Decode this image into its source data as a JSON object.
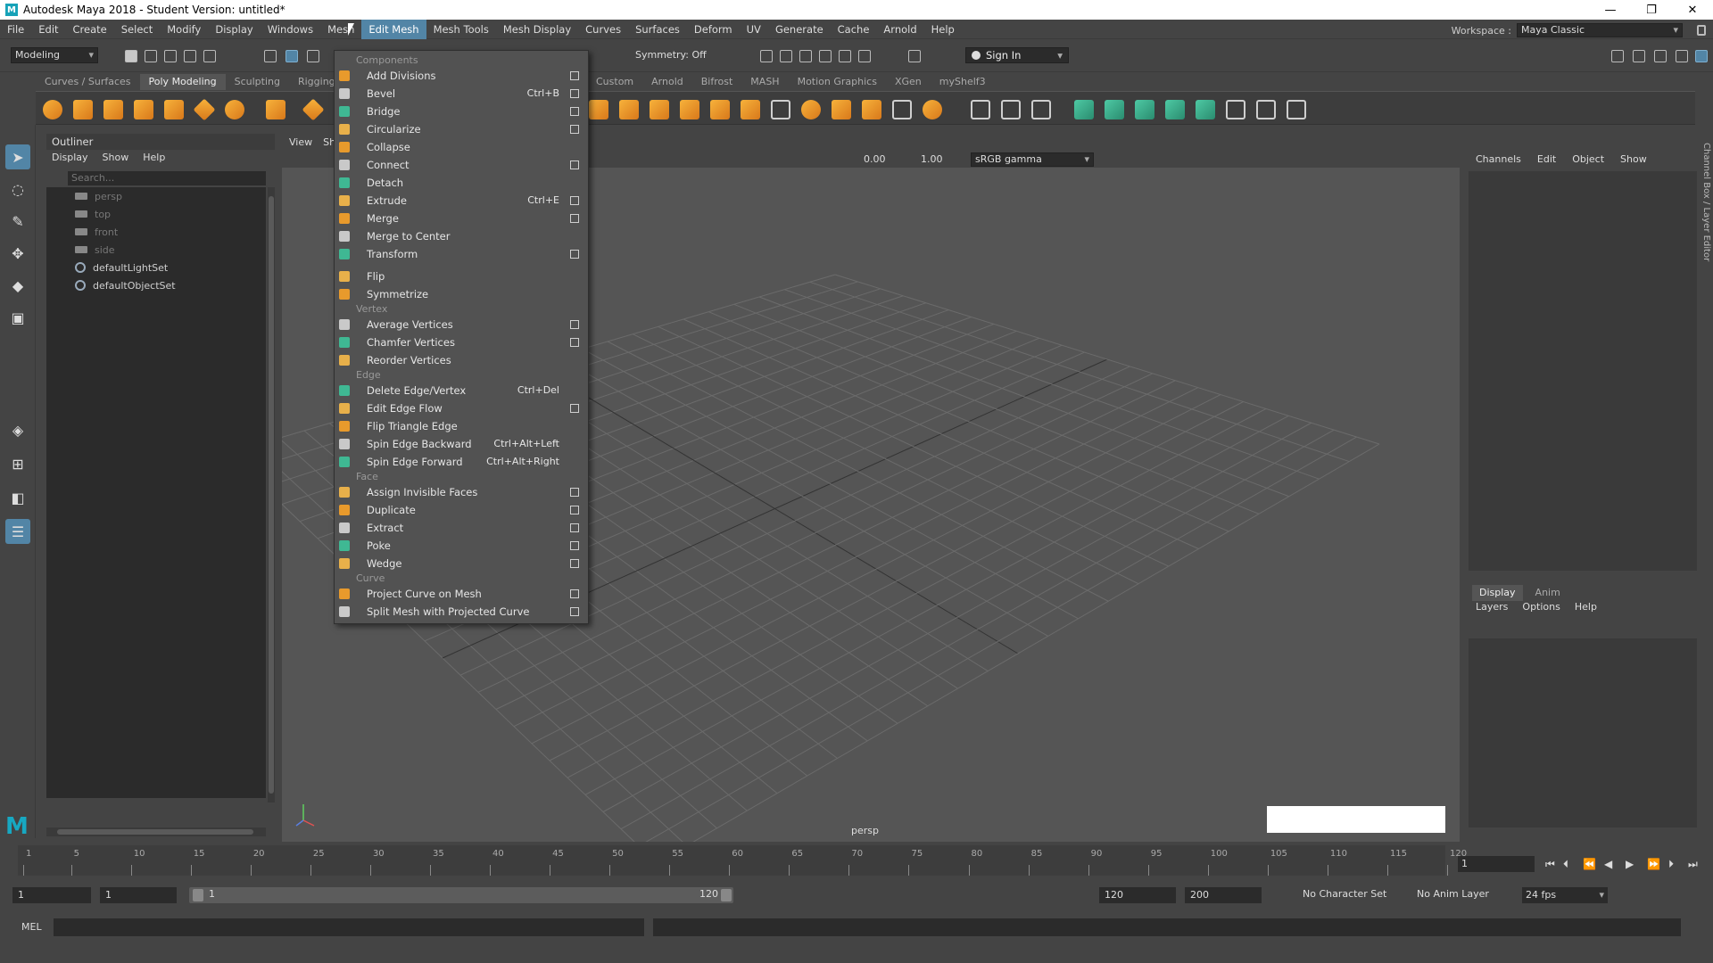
{
  "window": {
    "title": "Autodesk Maya 2018 - Student Version: untitled*",
    "minimize": "—",
    "maximize": "❐",
    "close": "✕"
  },
  "menubar": {
    "items": [
      "File",
      "Edit",
      "Create",
      "Select",
      "Modify",
      "Display",
      "Windows",
      "Mesh",
      "Edit Mesh",
      "Mesh Tools",
      "Mesh Display",
      "Curves",
      "Surfaces",
      "Deform",
      "UV",
      "Generate",
      "Cache",
      "Arnold",
      "Help"
    ],
    "active": "Edit Mesh",
    "workspace_label": "Workspace :",
    "workspace_value": "Maya Classic"
  },
  "statusline": {
    "mode": "Modeling",
    "symmetry": "Symmetry: Off",
    "sign_in": "Sign In"
  },
  "shelf": {
    "tabs": [
      "Curves / Surfaces",
      "Poly Modeling",
      "Sculpting",
      "Rigging"
    ],
    "tabs_right": [
      "Custom",
      "Arnold",
      "Bifrost",
      "MASH",
      "Motion Graphics",
      "XGen",
      "myShelf3"
    ],
    "active_tab": "Poly Modeling"
  },
  "outliner": {
    "title": "Outliner",
    "menu": [
      "Display",
      "Show",
      "Help"
    ],
    "search_placeholder": "Search...",
    "items": [
      {
        "label": "persp",
        "type": "camera",
        "dim": true
      },
      {
        "label": "top",
        "type": "camera",
        "dim": true
      },
      {
        "label": "front",
        "type": "camera",
        "dim": true
      },
      {
        "label": "side",
        "type": "camera",
        "dim": true
      },
      {
        "label": "defaultLightSet",
        "type": "set",
        "dim": false
      },
      {
        "label": "defaultObjectSet",
        "type": "set",
        "dim": false
      }
    ]
  },
  "viewport": {
    "menu": [
      "View",
      "Sh"
    ],
    "exposure": "0.00",
    "gamma_value": "1.00",
    "color_space": "sRGB gamma",
    "camera_label": "persp"
  },
  "channelbox": {
    "menu": [
      "Channels",
      "Edit",
      "Object",
      "Show"
    ],
    "layer_tabs": [
      "Display",
      "Anim"
    ],
    "layer_menu": [
      "Layers",
      "Options",
      "Help"
    ],
    "side_tab": "Channel Box / Layer Editor"
  },
  "timeslider": {
    "ticks": [
      "1",
      "5",
      "10",
      "15",
      "20",
      "25",
      "30",
      "35",
      "40",
      "45",
      "50",
      "55",
      "60",
      "65",
      "70",
      "75",
      "80",
      "85",
      "90",
      "95",
      "100",
      "105",
      "110",
      "115",
      "120"
    ],
    "current_frame": "1"
  },
  "rangeslider": {
    "start": "1",
    "start_inner": "1",
    "range_start_label": "1",
    "range_end_label": "120",
    "end_inner": "120",
    "end": "200",
    "character_set": "No Character Set",
    "anim_layer": "No Anim Layer",
    "fps": "24 fps"
  },
  "cmdline": {
    "label": "MEL"
  },
  "edit_mesh_menu": {
    "sections": [
      {
        "title": "Components",
        "items": [
          {
            "label": "Add Divisions",
            "shortcut": "",
            "option": true
          },
          {
            "label": "Bevel",
            "shortcut": "Ctrl+B",
            "option": true
          },
          {
            "label": "Bridge",
            "shortcut": "",
            "option": true
          },
          {
            "label": "Circularize",
            "shortcut": "",
            "option": true
          },
          {
            "label": "Collapse",
            "shortcut": "",
            "option": false
          },
          {
            "label": "Connect",
            "shortcut": "",
            "option": true
          },
          {
            "label": "Detach",
            "shortcut": "",
            "option": false
          },
          {
            "label": "Extrude",
            "shortcut": "Ctrl+E",
            "option": true
          },
          {
            "label": "Merge",
            "shortcut": "",
            "option": true
          },
          {
            "label": "Merge to Center",
            "shortcut": "",
            "option": false
          },
          {
            "label": "Transform",
            "shortcut": "",
            "option": true
          },
          {
            "label": "Flip",
            "shortcut": "",
            "option": false
          },
          {
            "label": "Symmetrize",
            "shortcut": "",
            "option": false
          }
        ]
      },
      {
        "title": "Vertex",
        "items": [
          {
            "label": "Average Vertices",
            "shortcut": "",
            "option": true
          },
          {
            "label": "Chamfer Vertices",
            "shortcut": "",
            "option": true
          },
          {
            "label": "Reorder Vertices",
            "shortcut": "",
            "option": false
          }
        ]
      },
      {
        "title": "Edge",
        "items": [
          {
            "label": "Delete Edge/Vertex",
            "shortcut": "Ctrl+Del",
            "option": false
          },
          {
            "label": "Edit Edge Flow",
            "shortcut": "",
            "option": true
          },
          {
            "label": "Flip Triangle Edge",
            "shortcut": "",
            "option": false
          },
          {
            "label": "Spin Edge Backward",
            "shortcut": "Ctrl+Alt+Left",
            "option": false
          },
          {
            "label": "Spin Edge Forward",
            "shortcut": "Ctrl+Alt+Right",
            "option": false
          }
        ]
      },
      {
        "title": "Face",
        "items": [
          {
            "label": "Assign Invisible Faces",
            "shortcut": "",
            "option": true
          },
          {
            "label": "Duplicate",
            "shortcut": "",
            "option": true
          },
          {
            "label": "Extract",
            "shortcut": "",
            "option": true
          },
          {
            "label": "Poke",
            "shortcut": "",
            "option": true
          },
          {
            "label": "Wedge",
            "shortcut": "",
            "option": true
          }
        ]
      },
      {
        "title": "Curve",
        "items": [
          {
            "label": "Project Curve on Mesh",
            "shortcut": "",
            "option": true
          },
          {
            "label": "Split Mesh with Projected Curve",
            "shortcut": "",
            "option": true
          }
        ]
      }
    ]
  },
  "colors": {
    "accent": "#5285a6",
    "icon_orange": "#e89a2c",
    "icon_teal": "#3fb893",
    "viewport_bg": "#555555",
    "grid_line": "#6b6b6b"
  }
}
